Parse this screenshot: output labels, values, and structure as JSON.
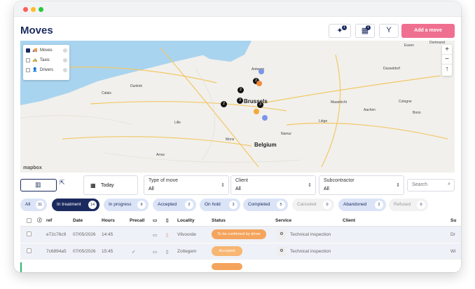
{
  "window": {
    "controls": [
      "close",
      "minimize",
      "maximize"
    ]
  },
  "header": {
    "title": "Moves",
    "buttons": [
      {
        "icon": "magic-wand-icon",
        "badge": "1"
      },
      {
        "icon": "calendar-icon",
        "badge": "1"
      },
      {
        "icon": "route-split-icon",
        "badge": ""
      }
    ],
    "add_label": "Add a move",
    "add_color": "#ef6f90"
  },
  "map": {
    "legend": [
      {
        "label": "Moves",
        "icon": "truck-icon",
        "checked": true
      },
      {
        "label": "Taxis",
        "icon": "taxi-icon",
        "checked": false
      },
      {
        "label": "Drivers",
        "icon": "driver-icon",
        "checked": false
      }
    ],
    "zoom": [
      "+",
      "−",
      "↑"
    ],
    "attribution": "mapbox",
    "cities": [
      {
        "name": "Antwerp",
        "big": false
      },
      {
        "name": "Dunkirk",
        "big": false
      },
      {
        "name": "Calais",
        "big": false
      },
      {
        "name": "Brussels",
        "big": true
      },
      {
        "name": "Belgium",
        "big": true
      },
      {
        "name": "Lille",
        "big": false
      },
      {
        "name": "Mons",
        "big": false
      },
      {
        "name": "Arras",
        "big": false
      },
      {
        "name": "Namur",
        "big": false
      },
      {
        "name": "Liège",
        "big": false
      },
      {
        "name": "Maastricht",
        "big": false
      },
      {
        "name": "Aachen",
        "big": false
      },
      {
        "name": "Cologne",
        "big": false
      },
      {
        "name": "Bonn",
        "big": false
      },
      {
        "name": "Dusseldorf",
        "big": false
      },
      {
        "name": "Essen",
        "big": false
      },
      {
        "name": "Dortmund",
        "big": false
      }
    ],
    "pins": [
      "2",
      "3",
      "2",
      "2",
      "3"
    ]
  },
  "filters": {
    "date": "Today",
    "type": {
      "label": "Type of move",
      "value": "All"
    },
    "client": {
      "label": "Client",
      "value": "All"
    },
    "subcontractor": {
      "label": "Subcontractor",
      "value": "All"
    },
    "search_placeholder": "Search"
  },
  "chips": [
    {
      "label": "All",
      "count": "31",
      "style": "blue"
    },
    {
      "label": "In treatment",
      "count": "14",
      "style": "dark"
    },
    {
      "label": "In progress",
      "count": "9",
      "style": "blue"
    },
    {
      "label": "Accepted",
      "count": "2",
      "style": "blue"
    },
    {
      "label": "On hold",
      "count": "3",
      "style": "blue"
    },
    {
      "label": "Completed",
      "count": "5",
      "style": "blue"
    },
    {
      "label": "Canceled",
      "count": "0",
      "style": "grey"
    },
    {
      "label": "Abandoned",
      "count": "2",
      "style": "blue"
    },
    {
      "label": "Refused",
      "count": "0",
      "style": "grey"
    }
  ],
  "table": {
    "columns": [
      "ref",
      "Date",
      "Hours",
      "Precall",
      "Locality",
      "Status",
      "Service",
      "Client",
      "Su"
    ],
    "rows": [
      {
        "ref": "e72c76c9",
        "date": "07/05/2026",
        "hours": "14:45",
        "precall": "",
        "locality": "Vilvoorde",
        "status": "To be confirmed by driver",
        "status_color": "#f5a45d",
        "service": "Technical inspection",
        "client": "",
        "sub": "Dr"
      },
      {
        "ref": "7c6894a5",
        "date": "07/05/2026",
        "hours": "15:45",
        "precall": "✓",
        "locality": "Zottegem",
        "status": "Accepted",
        "status_color": "#f7b672",
        "service": "Technical inspection",
        "client": "",
        "sub": "Wi"
      }
    ]
  }
}
